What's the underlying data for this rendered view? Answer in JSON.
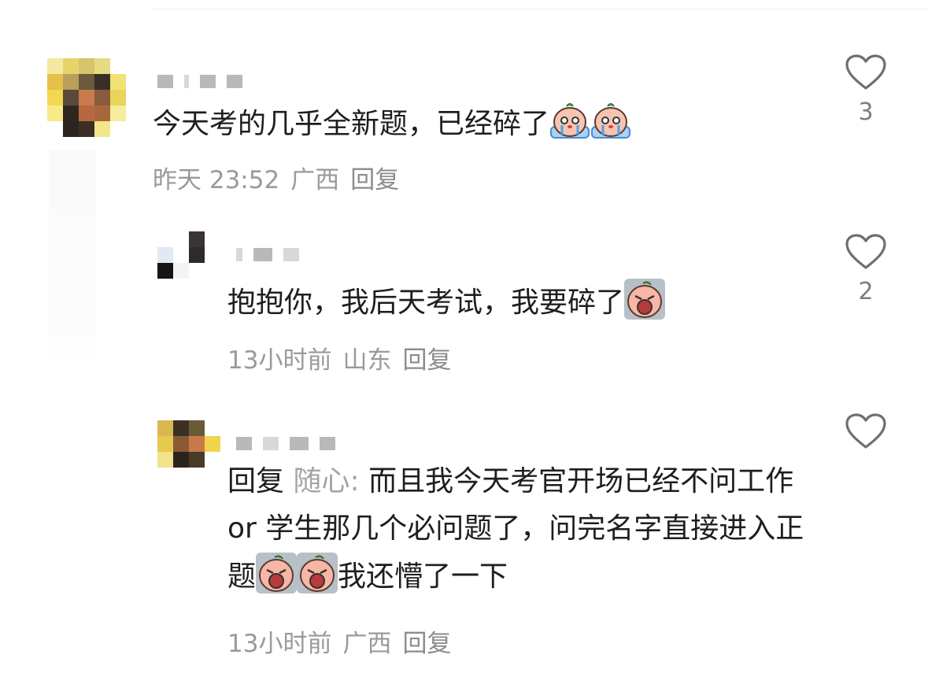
{
  "comments": [
    {
      "text": "今天考的几乎全新题，已经碎了",
      "emojis": [
        "crying-emoji",
        "crying-emoji"
      ],
      "time": "昨天 23:52",
      "location": "广西",
      "reply_label": "回复",
      "likes": "3"
    },
    {
      "text": "抱抱你，我后天考试，我要碎了",
      "emojis": [
        "wailing-emoji"
      ],
      "time": "13小时前",
      "location": "山东",
      "reply_label": "回复",
      "likes": "2"
    },
    {
      "reply_prefix": "回复",
      "reply_target": "随心:",
      "text_part1": "而且我今天考官开场已经不问工作 or 学生那几个必问题了，问完名字直接进入正题",
      "emojis": [
        "wailing-emoji",
        "wailing-emoji"
      ],
      "text_part2": "我还懵了一下",
      "time": "13小时前",
      "location": "广西",
      "reply_label": "回复",
      "likes": ""
    }
  ],
  "colors": {
    "text": "#1e1e1e",
    "meta": "#9a9a9a",
    "heart_stroke": "#6f6f6f",
    "reply_target": "#a4a4a4"
  }
}
